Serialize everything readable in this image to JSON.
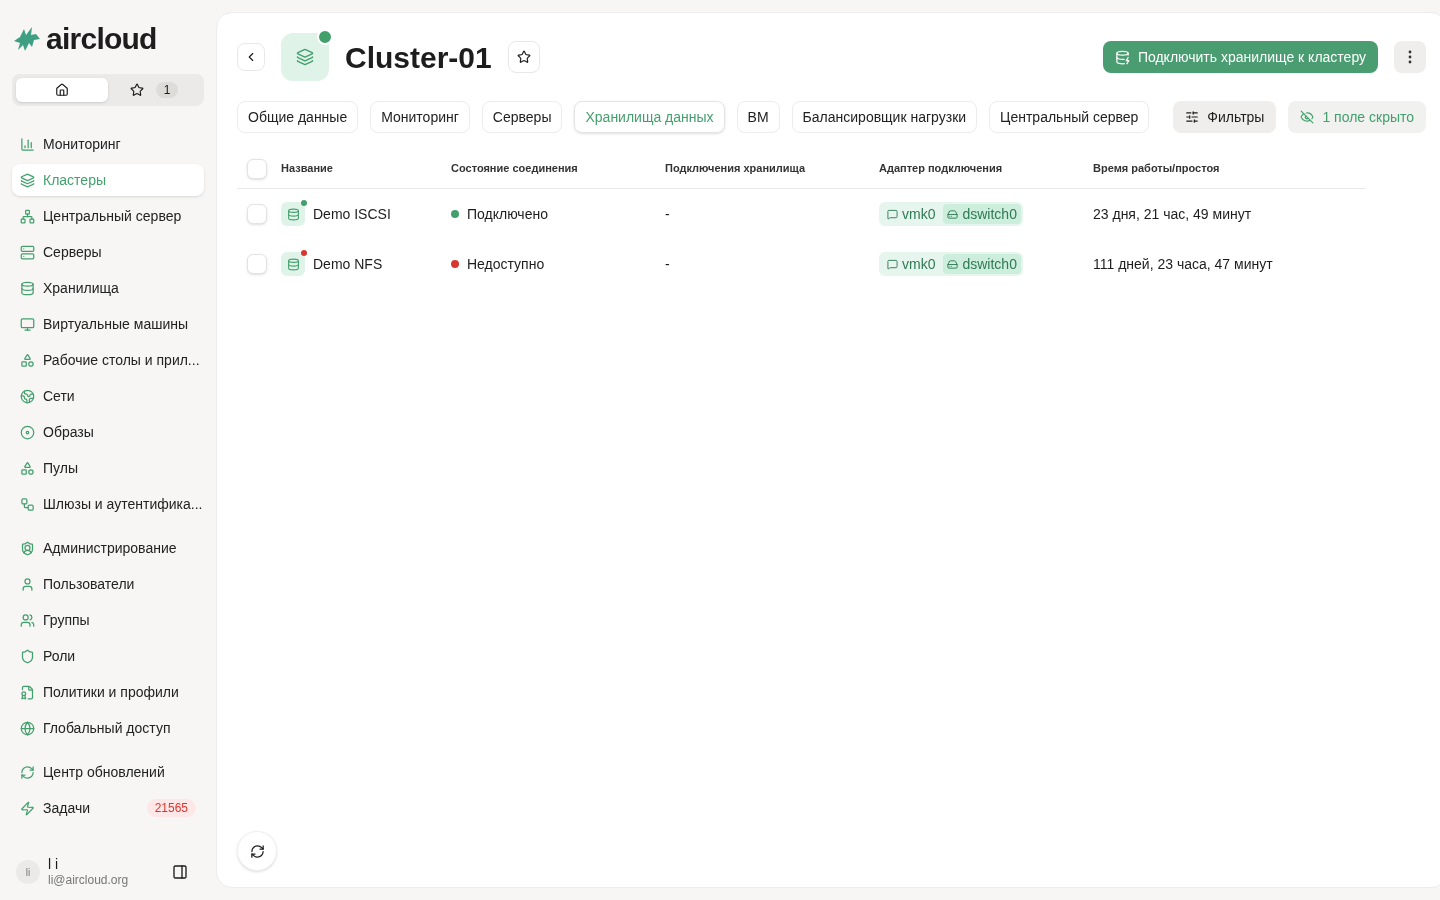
{
  "logo": {
    "text": "aircloud"
  },
  "sidebar": {
    "home_tabs": [
      {
        "kind": "home",
        "selected": true
      },
      {
        "kind": "favorites",
        "selected": false,
        "count": "1"
      }
    ],
    "groups": [
      [
        {
          "label": "Мониторинг",
          "selected": false
        },
        {
          "label": "Кластеры",
          "selected": true
        },
        {
          "label": "Центральный сервер",
          "selected": false
        },
        {
          "label": "Серверы",
          "selected": false
        },
        {
          "label": "Хранилища",
          "selected": false
        },
        {
          "label": "Виртуальные машины",
          "selected": false
        },
        {
          "label": "Рабочие столы и прил...",
          "selected": false
        },
        {
          "label": "Сети",
          "selected": false
        },
        {
          "label": "Образы",
          "selected": false
        },
        {
          "label": "Пулы",
          "selected": false
        },
        {
          "label": "Шлюзы и аутентифика...",
          "selected": false
        }
      ],
      [
        {
          "label": "Администрирование",
          "selected": false
        },
        {
          "label": "Пользователи",
          "selected": false
        },
        {
          "label": "Группы",
          "selected": false
        },
        {
          "label": "Роли",
          "selected": false
        },
        {
          "label": "Политики и профили",
          "selected": false
        },
        {
          "label": "Глобальный доступ",
          "selected": false
        }
      ],
      [
        {
          "label": "Центр обновлений",
          "selected": false
        },
        {
          "label": "Задачи",
          "selected": false,
          "badge": "21565"
        }
      ]
    ],
    "user": {
      "initials": "li",
      "name": "l i",
      "email": "li@aircloud.org"
    }
  },
  "header": {
    "title": "Cluster-01",
    "online": true,
    "primary_button": "Подключить хранилище к кластеру"
  },
  "tabs": [
    {
      "label": "Общие данные",
      "selected": false
    },
    {
      "label": "Мониторинг",
      "selected": false
    },
    {
      "label": "Серверы",
      "selected": false
    },
    {
      "label": "Хранилища данных",
      "selected": true
    },
    {
      "label": "ВМ",
      "selected": false
    },
    {
      "label": "Балансировщик нагрузки",
      "selected": false
    },
    {
      "label": "Центральный сервер",
      "selected": false
    }
  ],
  "filters_button": "Фильтры",
  "hidden_fields_button": "1 поле скрыто",
  "table": {
    "all_checked": false,
    "columns": [
      "Название",
      "Состояние соединения",
      "Подключения хранилища",
      "Адаптер подключения",
      "Время работы/простоя"
    ],
    "rows": [
      {
        "checked": false,
        "name": "Demo ISCSI",
        "color": "#43a06d",
        "status": "Подключено",
        "connections": "-",
        "adapter": "vmk0",
        "switch": "dswitch0",
        "uptime": "23 дня, 21 час, 49 минут"
      },
      {
        "checked": false,
        "name": "Demo NFS",
        "color": "#d8372f",
        "status": "Недоступно",
        "connections": "-",
        "adapter": "vmk0",
        "switch": "dswitch0",
        "uptime": "111 дней, 23 часа, 47 минут"
      }
    ]
  }
}
